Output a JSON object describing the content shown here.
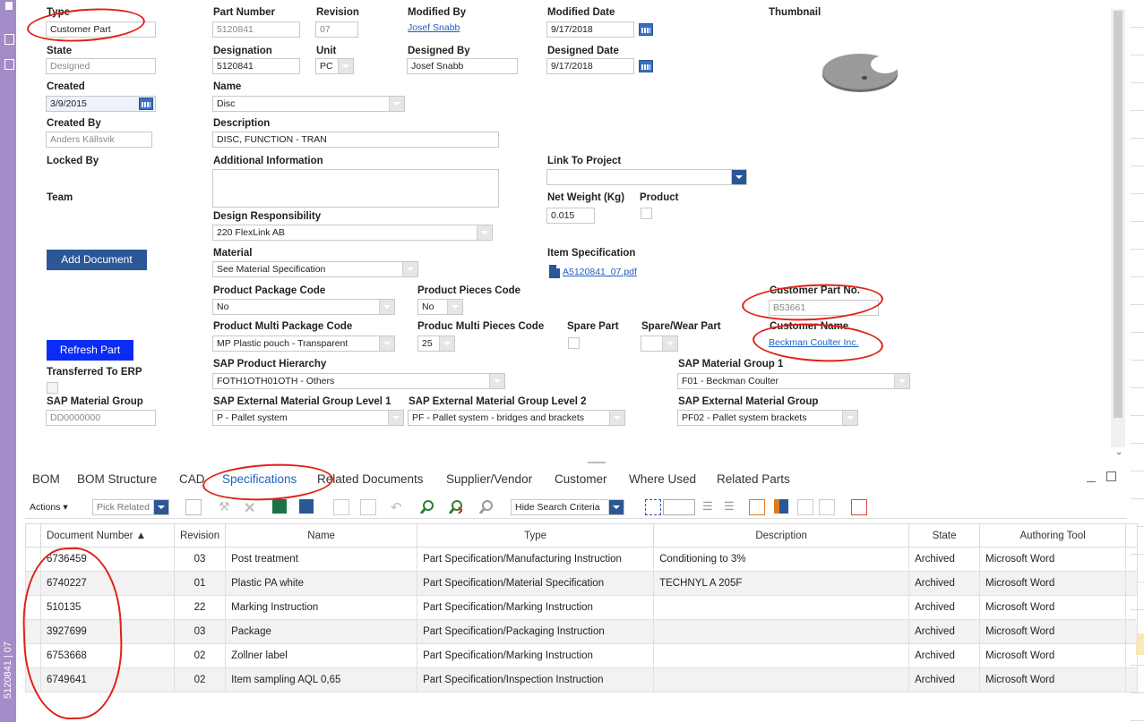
{
  "form": {
    "type": {
      "label": "Type",
      "value": "Customer Part"
    },
    "part_number": {
      "label": "Part Number",
      "value": "5120841"
    },
    "revision": {
      "label": "Revision",
      "value": "07"
    },
    "modified_by": {
      "label": "Modified By",
      "value": "Josef Snabb"
    },
    "modified_date": {
      "label": "Modified Date",
      "value": "9/17/2018"
    },
    "thumbnail": {
      "label": "Thumbnail"
    },
    "state": {
      "label": "State",
      "value": "Designed"
    },
    "designation": {
      "label": "Designation",
      "value": "5120841"
    },
    "unit": {
      "label": "Unit",
      "value": "PC"
    },
    "designed_by": {
      "label": "Designed By",
      "value": "Josef Snabb"
    },
    "designed_date": {
      "label": "Designed Date",
      "value": "9/17/2018"
    },
    "created": {
      "label": "Created",
      "value": "3/9/2015"
    },
    "name": {
      "label": "Name",
      "value": "Disc"
    },
    "created_by": {
      "label": "Created By",
      "value": "Anders Källsvik"
    },
    "description": {
      "label": "Description",
      "value": "DISC, FUNCTION - TRAN"
    },
    "locked_by": {
      "label": "Locked By"
    },
    "additional_info": {
      "label": "Additional Information"
    },
    "link_to_project": {
      "label": "Link To Project"
    },
    "team": {
      "label": "Team"
    },
    "net_weight": {
      "label": "Net Weight (Kg)",
      "value": "0.015"
    },
    "product": {
      "label": "Product"
    },
    "design_responsibility": {
      "label": "Design Responsibility",
      "value": "220 FlexLink AB"
    },
    "material": {
      "label": "Material",
      "value": "See Material Specification"
    },
    "item_specification": {
      "label": "Item Specification",
      "value": "A5120841_07.pdf"
    },
    "product_package_code": {
      "label": "Product Package Code",
      "value": "No"
    },
    "product_pieces_code": {
      "label": "Product Pieces Code",
      "value": "No"
    },
    "customer_part_no": {
      "label": "Customer Part No.",
      "value": "B53661"
    },
    "product_multi_package_code": {
      "label": "Product Multi Package Code",
      "value": "MP Plastic pouch - Transparent"
    },
    "produc_multi_pieces_code": {
      "label": "Produc Multi Pieces Code",
      "value": "25"
    },
    "spare_part": {
      "label": "Spare Part"
    },
    "spare_wear_part": {
      "label": "Spare/Wear Part"
    },
    "customer_name": {
      "label": "Customer Name",
      "value": "Beckman Coulter Inc."
    },
    "transferred_to_erp": {
      "label": "Transferred To ERP"
    },
    "sap_product_hierarchy": {
      "label": "SAP Product Hierarchy",
      "value": "FOTH1OTH01OTH - Others"
    },
    "sap_material_group_1": {
      "label": "SAP Material Group 1",
      "value": "F01 - Beckman Coulter"
    },
    "sap_material_group": {
      "label": "SAP Material Group",
      "value": "DD0000000"
    },
    "sap_ext_level1": {
      "label": "SAP External Material Group Level 1",
      "value": "P - Pallet system"
    },
    "sap_ext_level2": {
      "label": "SAP External Material Group Level 2",
      "value": "PF - Pallet system - bridges and brackets"
    },
    "sap_ext_group": {
      "label": "SAP External Material Group",
      "value": "PF02 - Pallet system brackets"
    }
  },
  "buttons": {
    "add_document": "Add Document",
    "refresh_part": "Refresh Part"
  },
  "tabs": [
    "BOM",
    "BOM Structure",
    "CAD",
    "Specifications",
    "Related Documents",
    "Supplier/Vendor",
    "Customer",
    "Where Used",
    "Related Parts"
  ],
  "active_tab": "Specifications",
  "toolbar": {
    "actions": "Actions",
    "pick_related": "Pick Related",
    "hide_search": "Hide Search Criteria"
  },
  "table": {
    "columns": [
      "Document Number ▲",
      "Revision",
      "Name",
      "Type",
      "Description",
      "State",
      "Authoring Tool"
    ],
    "rows": [
      [
        "6736459",
        "03",
        "Post treatment",
        "Part Specification/Manufacturing Instruction",
        "Conditioning to 3%",
        "Archived",
        "Microsoft Word"
      ],
      [
        "6740227",
        "01",
        "Plastic PA white",
        "Part Specification/Material Specification",
        "TECHNYL A 205F",
        "Archived",
        "Microsoft Word"
      ],
      [
        "510135",
        "22",
        "Marking Instruction",
        "Part Specification/Marking Instruction",
        "",
        "Archived",
        "Microsoft Word"
      ],
      [
        "3927699",
        "03",
        "Package",
        "Part Specification/Packaging Instruction",
        "",
        "Archived",
        "Microsoft Word"
      ],
      [
        "6753668",
        "02",
        "Zollner label",
        "Part Specification/Marking Instruction",
        "",
        "Archived",
        "Microsoft Word"
      ],
      [
        "6749641",
        "02",
        "Item sampling AQL 0,65",
        "Part Specification/Inspection Instruction",
        "",
        "Archived",
        "Microsoft Word"
      ]
    ]
  },
  "side_text": "5120841 | 07",
  "colors": {
    "accent": "#2b5797",
    "link": "#1f5fbf",
    "refresh": "#0a2cf5",
    "annotation": "#e0201a",
    "sidebar": "#a48cc8"
  }
}
